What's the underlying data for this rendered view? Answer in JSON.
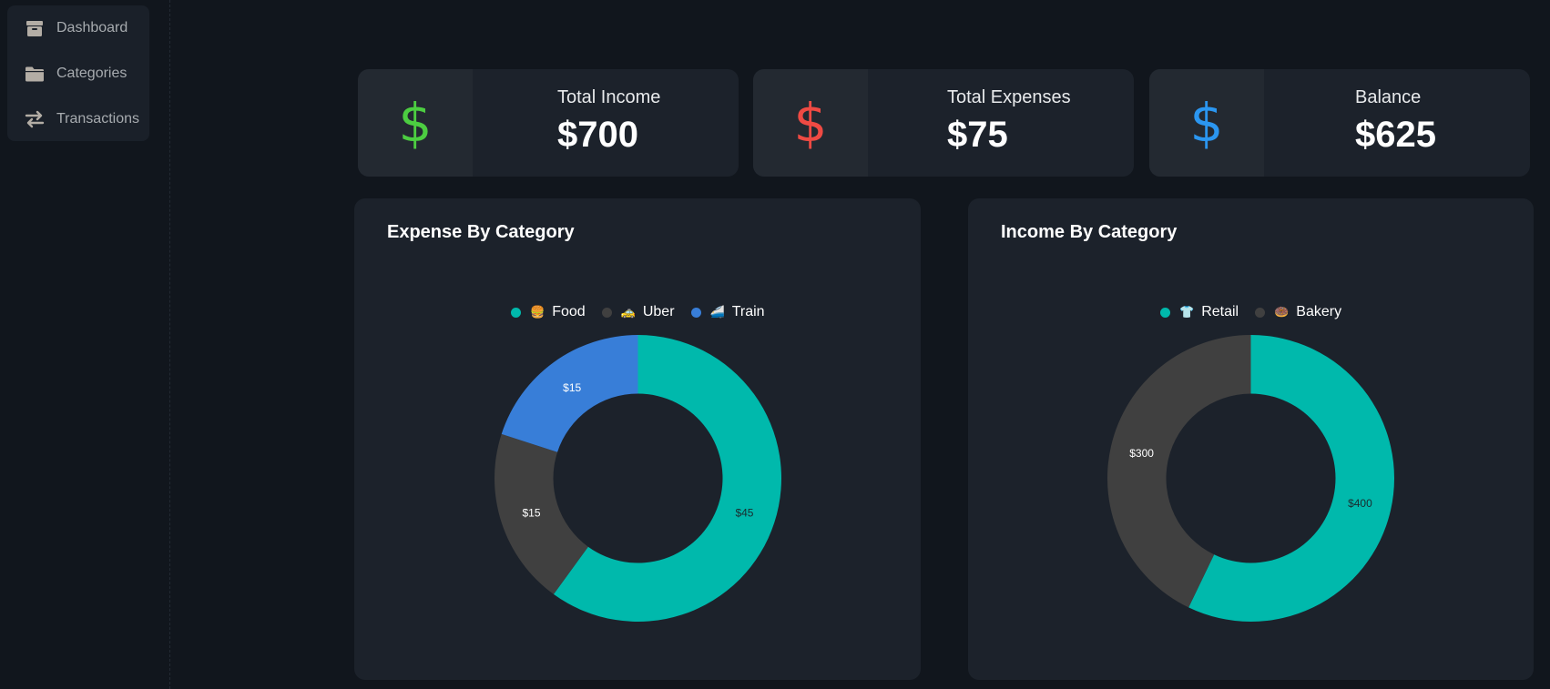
{
  "sidebar": {
    "items": [
      {
        "label": "Dashboard",
        "icon": "box-icon"
      },
      {
        "label": "Categories",
        "icon": "folder-icon"
      },
      {
        "label": "Transactions",
        "icon": "swap-arrows-icon"
      }
    ]
  },
  "stats": {
    "income": {
      "label": "Total Income",
      "value": "$700",
      "icon": "dollar-icon",
      "color": "#4ccd41"
    },
    "expenses": {
      "label": "Total Expenses",
      "value": "$75",
      "icon": "dollar-icon",
      "color": "#ef4a43"
    },
    "balance": {
      "label": "Balance",
      "value": "$625",
      "icon": "dollar-icon",
      "color": "#2b96f0"
    }
  },
  "expense_panel": {
    "title": "Expense By Category",
    "legend": [
      {
        "emoji": "🍔",
        "label": "Food",
        "color": "#00b9ac"
      },
      {
        "emoji": "🚕",
        "label": "Uber",
        "color": "#404040"
      },
      {
        "emoji": "🚄",
        "label": "Train",
        "color": "#387ed8"
      }
    ]
  },
  "income_panel": {
    "title": "Income By Category",
    "legend": [
      {
        "emoji": "👕",
        "label": "Retail",
        "color": "#00b9ac"
      },
      {
        "emoji": "🍩",
        "label": "Bakery",
        "color": "#404040"
      }
    ]
  },
  "chart_data": [
    {
      "type": "pie",
      "title": "Expense By Category",
      "categories": [
        "Food",
        "Uber",
        "Train"
      ],
      "values": [
        45,
        15,
        15
      ],
      "labels": [
        "$45",
        "$15",
        "$15"
      ],
      "colors": [
        "#00b9ac",
        "#404040",
        "#387ed8"
      ],
      "legend": "top"
    },
    {
      "type": "pie",
      "title": "Income By Category",
      "categories": [
        "Retail",
        "Bakery"
      ],
      "values": [
        400,
        300
      ],
      "labels": [
        "$400",
        "$300"
      ],
      "colors": [
        "#00b9ac",
        "#404040"
      ],
      "legend": "top"
    }
  ]
}
